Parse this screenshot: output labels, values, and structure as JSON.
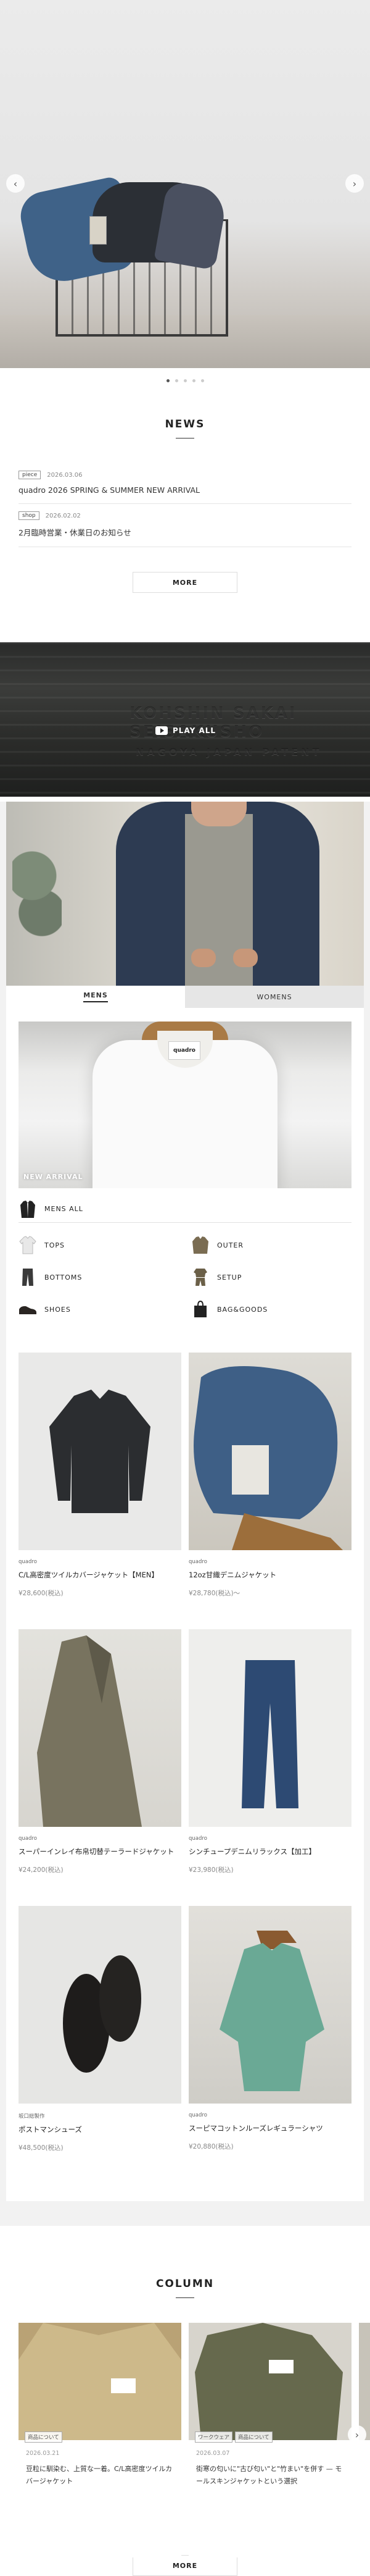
{
  "hero": {
    "prev": "‹",
    "next": "›",
    "slide_count": 5,
    "active_slide": 0
  },
  "news": {
    "title": "NEWS",
    "items": [
      {
        "category": "piece",
        "date": "2026.03.06",
        "title": "quadro 2026 SPRING & SUMMER NEW ARRIVAL"
      },
      {
        "category": "shop",
        "date": "2026.02.02",
        "title": "2月臨時営業・休業日のお知らせ"
      }
    ],
    "more": "MORE"
  },
  "video": {
    "play": "PLAY ALL",
    "emboss1": "KOHSHIN SAKAI SEISAKUSHO",
    "emboss2": "NAGOYA  JAPAN  PATENT"
  },
  "catalog": {
    "tabs": [
      {
        "label": "MENS"
      },
      {
        "label": "WOMENS"
      }
    ],
    "new_arrival": "NEW ARRIVAL",
    "label_brand": "quadro",
    "mens_all": "MENS ALL",
    "categories": [
      "TOPS",
      "OUTER",
      "BOTTOMS",
      "SETUP",
      "SHOES",
      "BAG&GOODS"
    ],
    "products": [
      {
        "brand": "quadro",
        "name": "C/L高密度ツイルカバージャケット【MEN】",
        "price": "¥28,600(税込)"
      },
      {
        "brand": "quadro",
        "name": "12oz甘織デニムジャケット",
        "price": "¥28,780(税込)～"
      },
      {
        "brand": "quadro",
        "name": "スーパーインレイ布帛切替テーラードジャケット",
        "price": "¥24,200(税込)"
      },
      {
        "brand": "quadro",
        "name": "シンチュープデニムリラックス【加工】",
        "price": "¥23,980(税込)"
      },
      {
        "brand": "坂口総製作",
        "name": "ポストマンシューズ",
        "price": "¥48,500(税込)"
      },
      {
        "brand": "quadro",
        "name": "スーピマコットンルーズレギュラーシャツ",
        "price": "¥20,880(税込)"
      }
    ]
  },
  "column": {
    "title": "COLUMN",
    "cards": [
      {
        "tags": [
          "商品について"
        ],
        "date": "2026.03.21",
        "text": "豆粒に馴染む、上質な一着。C/L高密度ツイルカバージャケット"
      },
      {
        "tags": [
          "ワークウェア",
          "商品について"
        ],
        "date": "2026.03.07",
        "text": "街寒の匂いに\"古び匂い\"と\"竹まい\"を併す — モールスキンジャケットという選択"
      },
      {
        "tags": [
          ""
        ],
        "date": "",
        "text": ""
      }
    ],
    "more": "MORE",
    "next": "›"
  },
  "colors": {
    "accent": "#222222",
    "tab_inactive": "#e6e6e6",
    "catalog_bg": "#f2f2f2"
  }
}
